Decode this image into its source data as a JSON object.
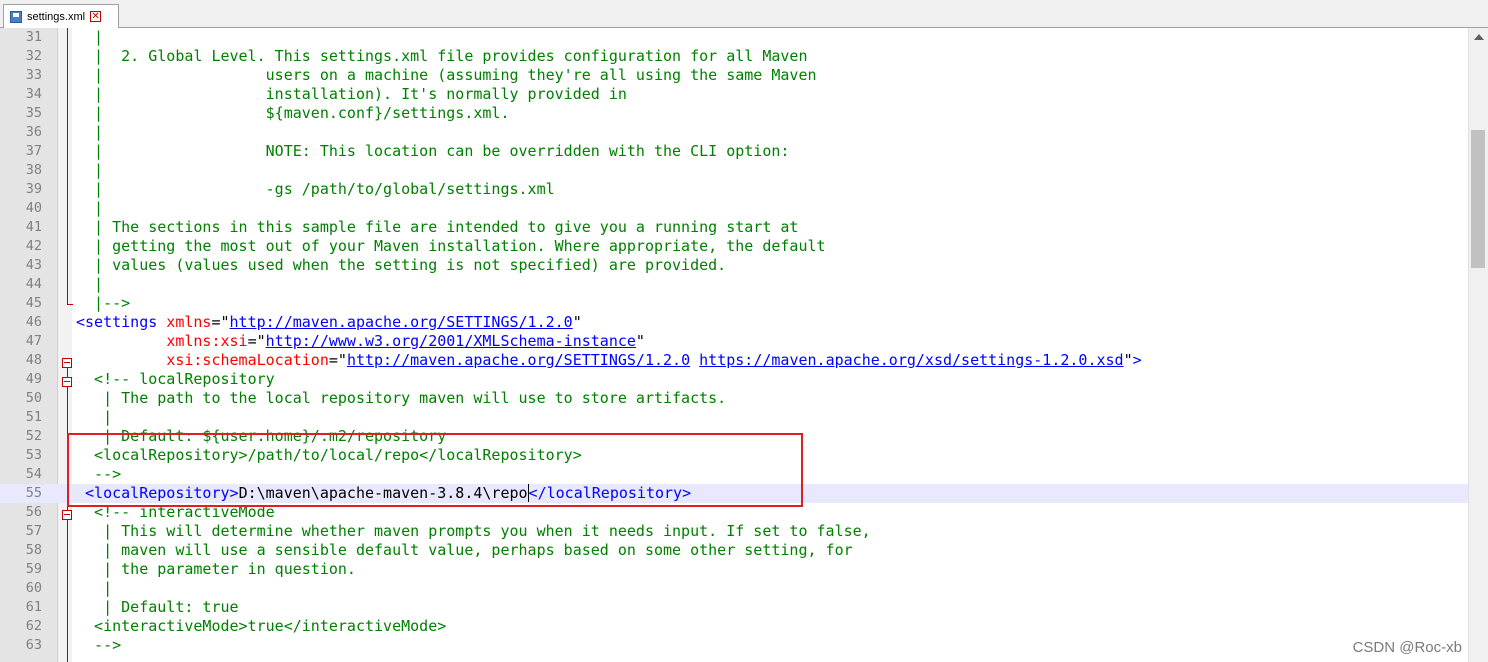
{
  "tab": {
    "label": "settings.xml",
    "close_glyph": "✕"
  },
  "watermark": "CSDN @Roc-xb",
  "lines": {
    "l31": {
      "n": "31",
      "c": "  |"
    },
    "l32": {
      "n": "32",
      "c": "  |  2. Global Level. This settings.xml file provides configuration for all Maven"
    },
    "l33": {
      "n": "33",
      "c": "  |                  users on a machine (assuming they're all using the same Maven"
    },
    "l34": {
      "n": "34",
      "c": "  |                  installation). It's normally provided in"
    },
    "l35": {
      "n": "35",
      "c": "  |                  ${maven.conf}/settings.xml."
    },
    "l36": {
      "n": "36",
      "c": "  |"
    },
    "l37": {
      "n": "37",
      "c": "  |                  NOTE: This location can be overridden with the CLI option:"
    },
    "l38": {
      "n": "38",
      "c": "  |"
    },
    "l39": {
      "n": "39",
      "c": "  |                  -gs /path/to/global/settings.xml"
    },
    "l40": {
      "n": "40",
      "c": "  |"
    },
    "l41": {
      "n": "41",
      "c": "  | The sections in this sample file are intended to give you a running start at"
    },
    "l42": {
      "n": "42",
      "c": "  | getting the most out of your Maven installation. Where appropriate, the default"
    },
    "l43": {
      "n": "43",
      "c": "  | values (values used when the setting is not specified) are provided."
    },
    "l44": {
      "n": "44",
      "c": "  |"
    },
    "l45": {
      "n": "45",
      "c": "  |-->"
    },
    "l46": {
      "n": "46",
      "open": "<settings",
      "attr": " xmlns",
      "eq": "=\"",
      "url": "http://maven.apache.org/SETTINGS/1.2.0",
      "q": "\""
    },
    "l47": {
      "n": "47",
      "pad": "          ",
      "attr": "xmlns:xsi",
      "eq": "=\"",
      "url": "http://www.w3.org/2001/XMLSchema-instance",
      "q": "\""
    },
    "l48": {
      "n": "48",
      "pad": "          ",
      "attr": "xsi:schemaLocation",
      "eq": "=\"",
      "url1": "http://maven.apache.org/SETTINGS/1.2.0",
      "sp": " ",
      "url2": "https://maven.apache.org/xsd/settings-1.2.0.xsd",
      "q": "\"",
      "close": ">"
    },
    "l49": {
      "n": "49",
      "c": "  <!-- localRepository"
    },
    "l50": {
      "n": "50",
      "c": "   | The path to the local repository maven will use to store artifacts."
    },
    "l51": {
      "n": "51",
      "c": "   |"
    },
    "l52": {
      "n": "52",
      "c": "   | Default: ${user.home}/.m2/repository"
    },
    "l53": {
      "n": "53",
      "c": "  <localRepository>/path/to/local/repo</localRepository>"
    },
    "l54": {
      "n": "54",
      "c": "  -->"
    },
    "l55": {
      "n": "55",
      "open": " <localRepository>",
      "value": "D:\\maven\\apache-maven-3.8.4\\repo",
      "close": "</localRepository>"
    },
    "l56": {
      "n": "56",
      "c": "  <!-- interactiveMode"
    },
    "l57": {
      "n": "57",
      "c": "   | This will determine whether maven prompts you when it needs input. If set to false,"
    },
    "l58": {
      "n": "58",
      "c": "   | maven will use a sensible default value, perhaps based on some other setting, for"
    },
    "l59": {
      "n": "59",
      "c": "   | the parameter in question."
    },
    "l60": {
      "n": "60",
      "c": "   |"
    },
    "l61": {
      "n": "61",
      "c": "   | Default: true"
    },
    "l62": {
      "n": "62",
      "c": "  <interactiveMode>true</interactiveMode>"
    },
    "l63": {
      "n": "63",
      "c": "  -->"
    }
  },
  "colors": {
    "tag": "#0000ff",
    "attribute": "#ff0000",
    "string": "#8000ff",
    "comment": "#008000",
    "highlight": "#e02020"
  }
}
